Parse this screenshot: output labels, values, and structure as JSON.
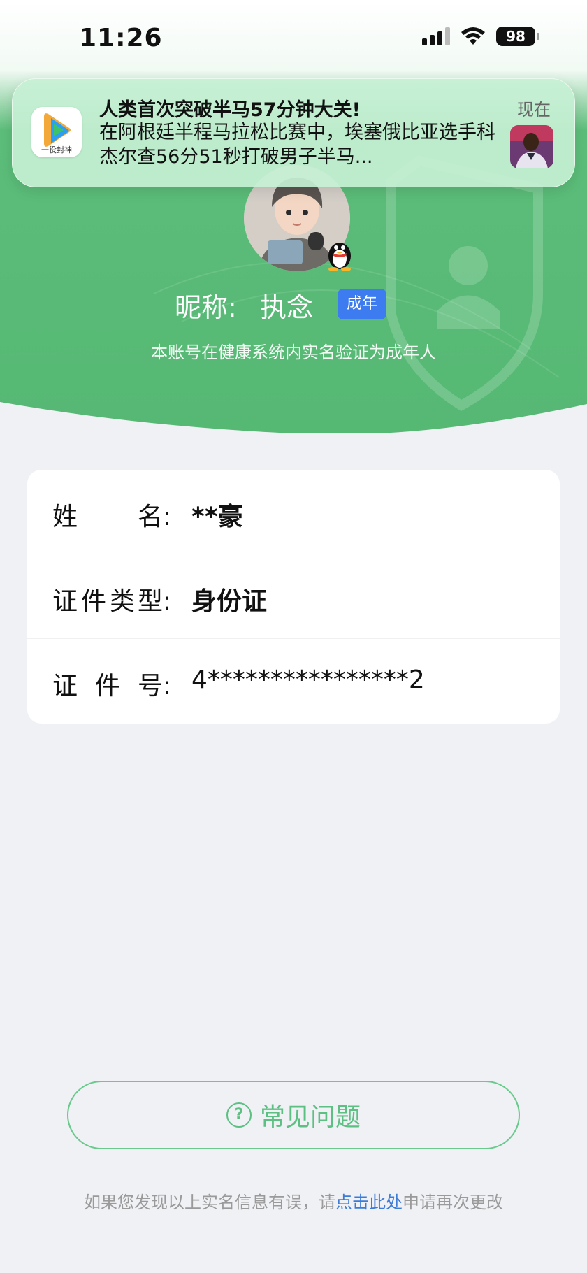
{
  "status_bar": {
    "time": "11:26",
    "battery": "98"
  },
  "notification": {
    "app_caption": "一役封神",
    "title": "人类首次突破半马57分钟大关!",
    "body": "在阿根廷半程马拉松比赛中，埃塞俄比亚选手科杰尔查56分51秒打破男子半马...",
    "time": "现在"
  },
  "profile": {
    "nickname_label": "昵称:",
    "nickname": "执念",
    "age_badge": "成年",
    "verify_note": "本账号在健康系统内实名验证为成年人"
  },
  "info": {
    "rows": [
      {
        "label_chars": [
          "姓",
          "名:"
        ],
        "value": "**豪"
      },
      {
        "label_chars": [
          "证",
          "件",
          "类",
          "型:"
        ],
        "value": "身份证"
      },
      {
        "label_chars": [
          "证",
          "件",
          "号:"
        ],
        "value": "4****************2"
      }
    ]
  },
  "faq": {
    "label": "常见问题"
  },
  "footer": {
    "prefix": "如果您发现以上实名信息有误，请",
    "link": "点击此处",
    "suffix": "申请再次更改"
  },
  "colors": {
    "hero_green": "#5cbd7a",
    "accent_green": "#5cc083",
    "badge_blue": "#3c7cf0",
    "link_blue": "#3c7cd8",
    "page_bg": "#eff1f5"
  }
}
